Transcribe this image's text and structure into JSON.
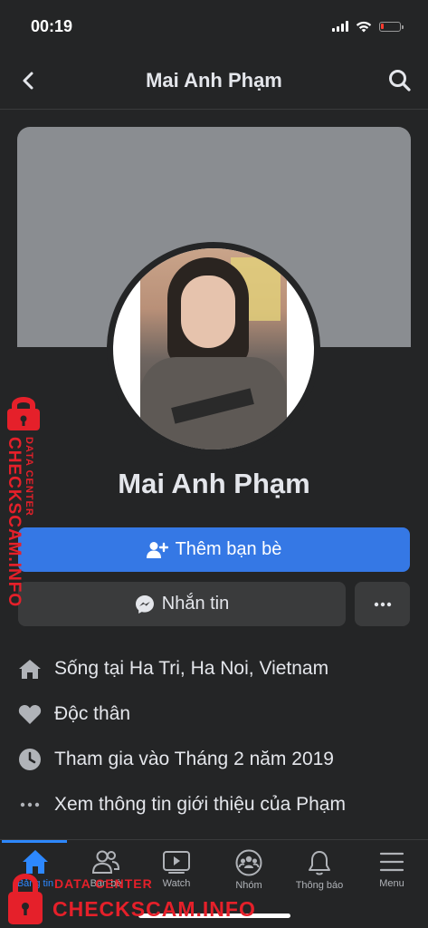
{
  "status_bar": {
    "time": "00:19",
    "battery_level": 0.15
  },
  "nav": {
    "title": "Mai Anh Phạm",
    "back_icon": "chevron-left-icon",
    "search_icon": "search-icon"
  },
  "profile": {
    "name": "Mai Anh Phạm"
  },
  "actions": {
    "add_friend_label": "Thêm bạn bè",
    "message_label": "Nhắn tin",
    "more_label": "···"
  },
  "info": {
    "lives_prefix": "Sống tại ",
    "lives_place": "Ha Tri, Ha Noi, Vietnam",
    "relationship": "Độc thân",
    "joined": "Tham gia vào Tháng 2 năm 2019",
    "about": "Xem thông tin giới thiệu của Phạm"
  },
  "tabs": [
    {
      "label": "Bảng tin",
      "icon": "home-icon",
      "active": true
    },
    {
      "label": "Bạn bè",
      "icon": "friends-icon"
    },
    {
      "label": "Watch",
      "icon": "watch-icon"
    },
    {
      "label": "Nhóm",
      "icon": "groups-icon"
    },
    {
      "label": "Thông báo",
      "icon": "bell-icon"
    },
    {
      "label": "Menu",
      "icon": "menu-icon"
    }
  ],
  "watermark": {
    "side_small": "DATA CENTER",
    "side_big": "CHECKSCAM.INFO",
    "bottom_small": "DATA CENTER",
    "bottom_big": "CHECKSCAM.INFO",
    "color": "#e5202a"
  },
  "colors": {
    "accent": "#3578e5",
    "background": "#242526",
    "button_gray": "#3a3b3c"
  }
}
